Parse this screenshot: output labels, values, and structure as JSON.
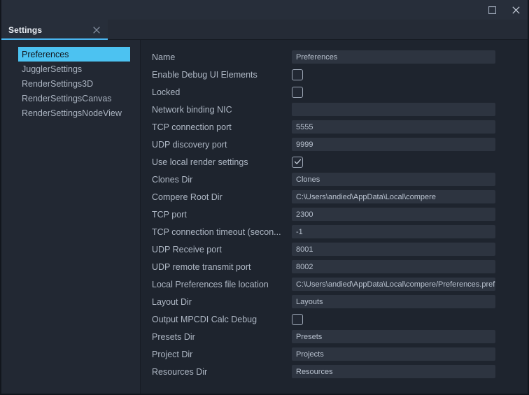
{
  "window": {
    "maximize_label": "Maximize",
    "close_label": "Close"
  },
  "tab": {
    "label": "Settings",
    "close_label": "×",
    "accent_color": "#4ab5ef"
  },
  "sidebar": {
    "selected_color": "#4cc2f1",
    "items": [
      {
        "label": "Preferences",
        "selected": true
      },
      {
        "label": "JugglerSettings",
        "selected": false
      },
      {
        "label": "RenderSettings3D",
        "selected": false
      },
      {
        "label": "RenderSettingsCanvas",
        "selected": false
      },
      {
        "label": "RenderSettingsNodeView",
        "selected": false
      }
    ]
  },
  "form": {
    "rows": [
      {
        "label": "Name",
        "type": "text",
        "value": "Preferences"
      },
      {
        "label": "Enable Debug UI Elements",
        "type": "checkbox",
        "checked": false
      },
      {
        "label": "Locked",
        "type": "checkbox",
        "checked": false
      },
      {
        "label": "Network binding NIC",
        "type": "text",
        "value": ""
      },
      {
        "label": "TCP connection port",
        "type": "text",
        "value": "5555"
      },
      {
        "label": "UDP discovery port",
        "type": "text",
        "value": "9999"
      },
      {
        "label": "Use local render settings",
        "type": "checkbox",
        "checked": true
      },
      {
        "label": "Clones Dir",
        "type": "text",
        "value": "Clones"
      },
      {
        "label": "Compere Root Dir",
        "type": "text",
        "value": "C:\\Users\\andied\\AppData\\Local\\compere"
      },
      {
        "label": "TCP port",
        "type": "text",
        "value": "2300"
      },
      {
        "label": "TCP connection timeout (secon...",
        "type": "text",
        "value": "-1"
      },
      {
        "label": "UDP Receive port",
        "type": "text",
        "value": "8001"
      },
      {
        "label": "UDP remote transmit port",
        "type": "text",
        "value": "8002"
      },
      {
        "label": "Local Preferences file location",
        "type": "text",
        "value": "C:\\Users\\andied\\AppData\\Local\\compere/Preferences.pref"
      },
      {
        "label": "Layout Dir",
        "type": "text",
        "value": "Layouts"
      },
      {
        "label": "Output MPCDI Calc Debug",
        "type": "checkbox",
        "checked": false
      },
      {
        "label": "Presets Dir",
        "type": "text",
        "value": "Presets"
      },
      {
        "label": "Project Dir",
        "type": "text",
        "value": "Projects"
      },
      {
        "label": "Resources Dir",
        "type": "text",
        "value": "Resources"
      }
    ]
  }
}
